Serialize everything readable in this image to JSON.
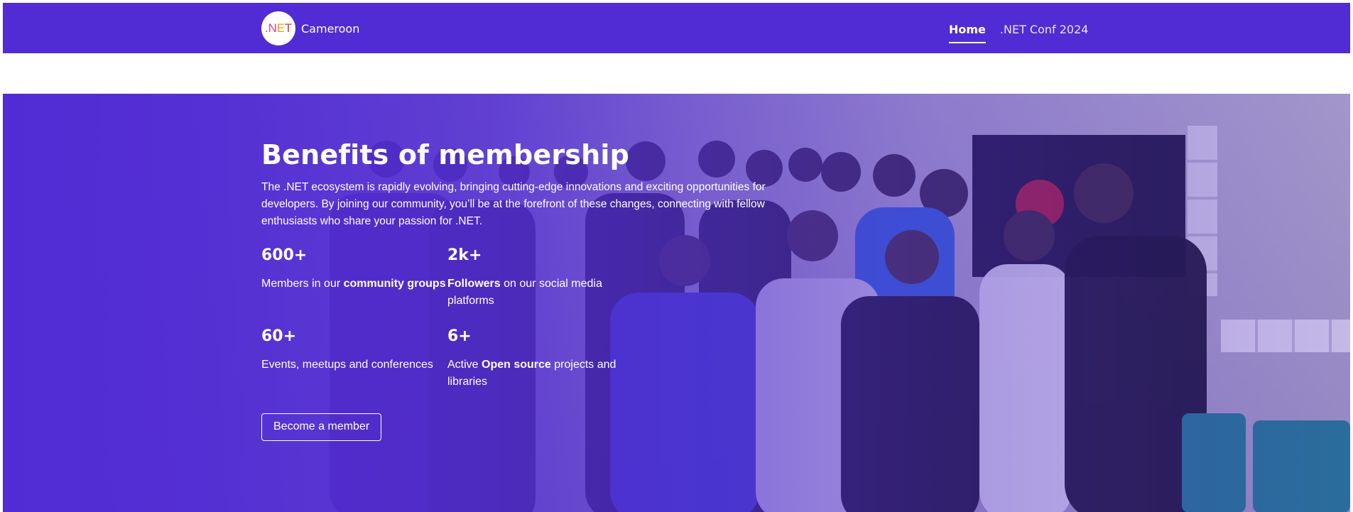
{
  "navbar": {
    "brand": {
      "logo_parts": [
        ".",
        "N",
        "E",
        "T"
      ],
      "name": "Cameroon"
    },
    "links": [
      {
        "label": "Home",
        "active": true
      },
      {
        "label": ".NET Conf 2024",
        "active": false
      }
    ]
  },
  "hero": {
    "title": "Benefits of membership",
    "description": "The .NET ecosystem is rapidly evolving, bringing cutting-edge innovations and exciting opportunities for developers. By joining our community, you’ll be at the forefront of these changes, connecting with fellow enthusiasts who share your passion for .NET.",
    "stats": [
      {
        "value": "600+",
        "pre": "Members in our ",
        "bold": "community groups",
        "post": ""
      },
      {
        "value": "2k+",
        "pre": "",
        "bold": "Followers",
        "post": " on our social media platforms"
      },
      {
        "value": "60+",
        "pre": "Events, meetups and conferences",
        "bold": "",
        "post": ""
      },
      {
        "value": "6+",
        "pre": "Active ",
        "bold": "Open source",
        "post": " projects and libraries"
      }
    ],
    "cta_label": "Become a member",
    "image_description": "Group photo of community members wearing .NET t-shirts"
  },
  "colors": {
    "brand_purple": "#512bd4",
    "white": "#ffffff"
  }
}
